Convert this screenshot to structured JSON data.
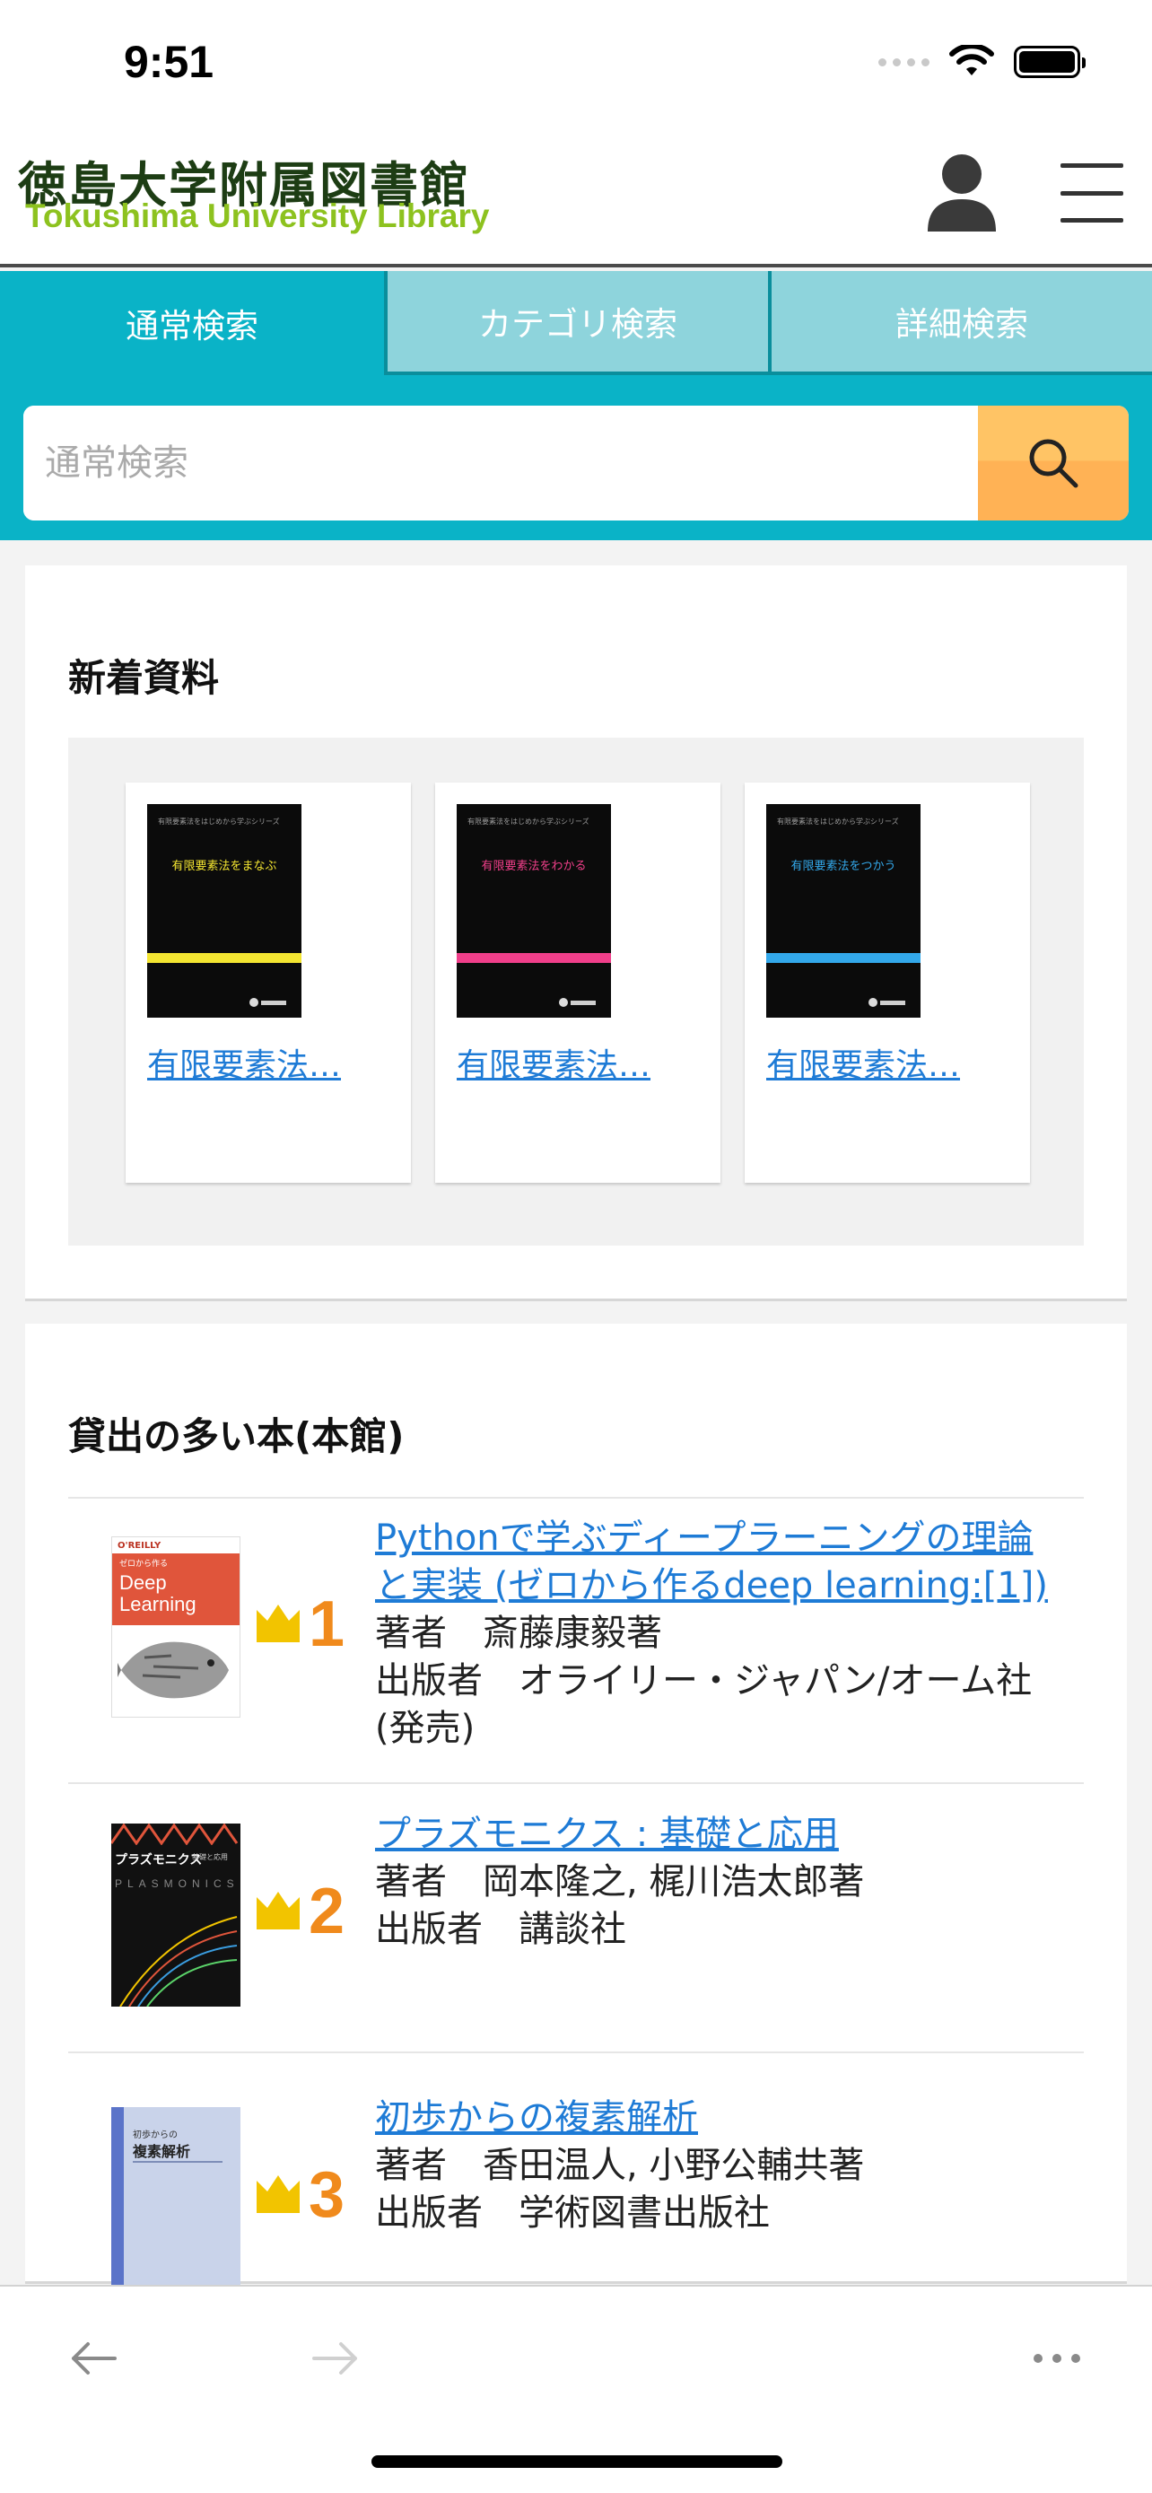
{
  "status_bar": {
    "time": "9:51",
    "icons": [
      "signal-icon",
      "wifi-icon",
      "battery-icon"
    ]
  },
  "header": {
    "logo_jp": "徳島大学附属図書館",
    "logo_en": "Tokushima University Library",
    "logo_colors": {
      "jp": "#1d3d14",
      "en": "#8dc21f"
    }
  },
  "search": {
    "tabs": [
      {
        "label": "通常検索",
        "active": true
      },
      {
        "label": "カテゴリ検索",
        "active": false
      },
      {
        "label": "詳細検索",
        "active": false
      }
    ],
    "placeholder": "通常検索",
    "accent": "#0ab3c7",
    "button_color": "#ffb255"
  },
  "new_arrivals": {
    "title": "新着資料",
    "books": [
      {
        "link": "有限要素法…",
        "cover_series": "有限要素法をはじめから学ぶシリーズ",
        "cover_title": "有限要素法をまなぶ",
        "stripe_color": "#f3e531",
        "title_color": "#f3e531"
      },
      {
        "link": "有限要素法…",
        "cover_series": "有限要素法をはじめから学ぶシリーズ",
        "cover_title": "有限要素法をわかる",
        "stripe_color": "#f03f8a",
        "title_color": "#f03f8a"
      },
      {
        "link": "有限要素法…",
        "cover_series": "有限要素法をはじめから学ぶシリーズ",
        "cover_title": "有限要素法をつかう",
        "stripe_color": "#33a8ea",
        "title_color": "#33a8ea"
      }
    ]
  },
  "ranking": {
    "title": "貸出の多い本(本館)",
    "items": [
      {
        "rank": "1",
        "title": "Pythonで学ぶディープラーニングの理論と実装 (ゼロから作るdeep learning:[1])",
        "author": "著者　斎藤康毅著",
        "publisher": "出版者　オライリー・ジャパン/オーム社 (発売)",
        "cover_text": [
          "O'REILLY",
          "ゼロから作る",
          "Deep",
          "Learning"
        ]
      },
      {
        "rank": "2",
        "title": "プラズモニクス : 基礎と応用",
        "author": "著者　岡本隆之, 梶川浩太郎著",
        "publisher": "出版者　講談社",
        "cover_text": [
          "プラズモニクス",
          "基礎と応用",
          "PLASMONICS"
        ]
      },
      {
        "rank": "3",
        "title": "初歩からの複素解析",
        "author": "著者　香田温人, 小野公輔共著",
        "publisher": "出版者　学術図書出版社",
        "cover_text": [
          "初歩からの",
          "複素解析"
        ]
      }
    ]
  },
  "toolbar": {
    "icons": [
      "back-arrow-icon",
      "forward-arrow-icon",
      "more-icon"
    ]
  }
}
